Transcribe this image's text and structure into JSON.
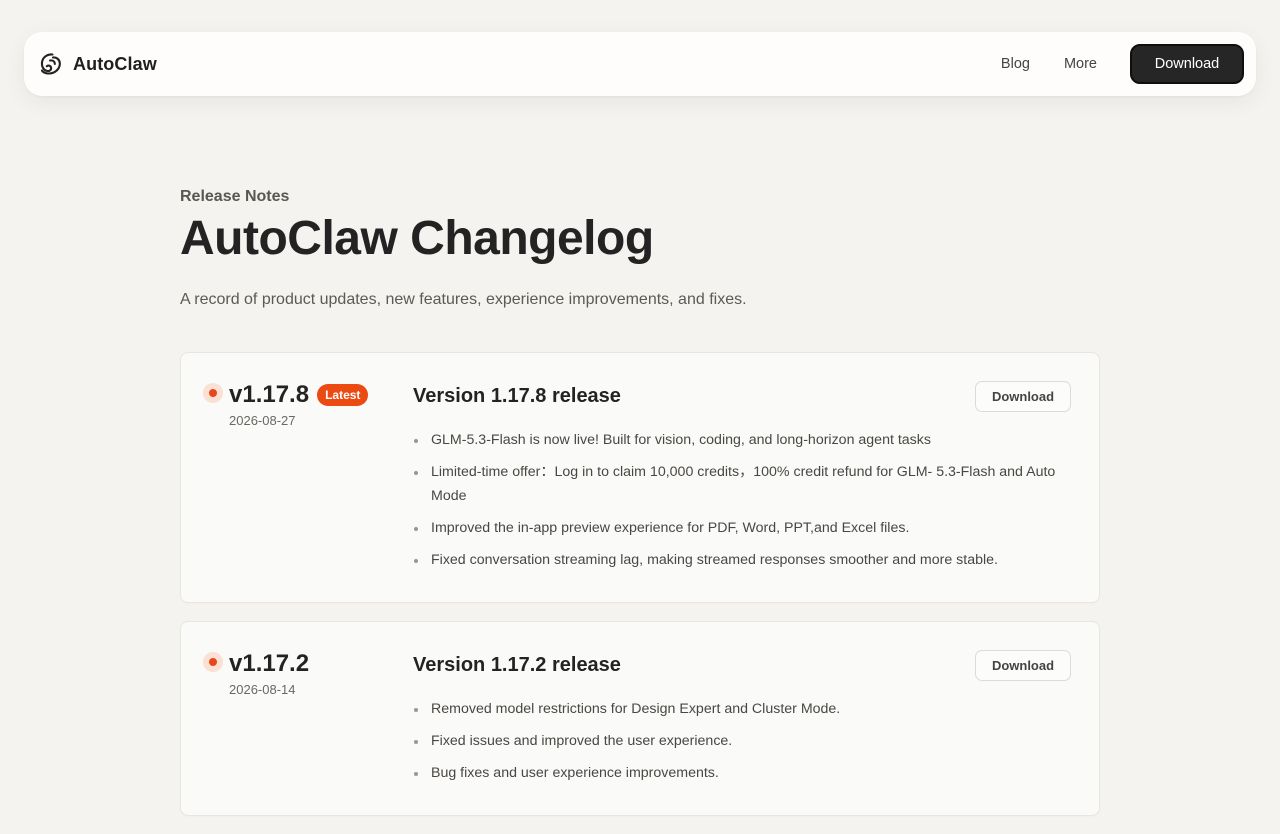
{
  "header": {
    "brand": "AutoClaw",
    "nav": [
      {
        "label": "Blog"
      },
      {
        "label": "More"
      }
    ],
    "download_label": "Download"
  },
  "intro": {
    "eyebrow": "Release Notes",
    "title": "AutoClaw Changelog",
    "subtitle": "A record of product updates, new features, experience improvements, and fixes."
  },
  "releases": [
    {
      "version": "v1.17.8",
      "badge": "Latest",
      "date": "2026-08-27",
      "title": "Version 1.17.8 release",
      "download_label": "Download",
      "notes": [
        "GLM-5.3-Flash is now live! Built for vision, coding, and long-horizon agent tasks",
        "Limited-time offer：Log in to claim 10,000 credits，100% credit refund for GLM- 5.3-Flash and Auto Mode",
        "Improved the in-app preview experience for PDF, Word, PPT,and Excel files.",
        "Fixed conversation streaming lag, making streamed responses smoother and more stable."
      ]
    },
    {
      "version": "v1.17.2",
      "date": "2026-08-14",
      "title": "Version 1.17.2 release",
      "download_label": "Download",
      "notes": [
        "Removed model restrictions for Design Expert and Cluster Mode.",
        "Fixed issues and improved the user experience.",
        "Bug fixes and user experience improvements."
      ]
    }
  ],
  "colors": {
    "accent": "#eb4a12",
    "page_background": "#f5f3ef",
    "primary_button": "#262626"
  }
}
